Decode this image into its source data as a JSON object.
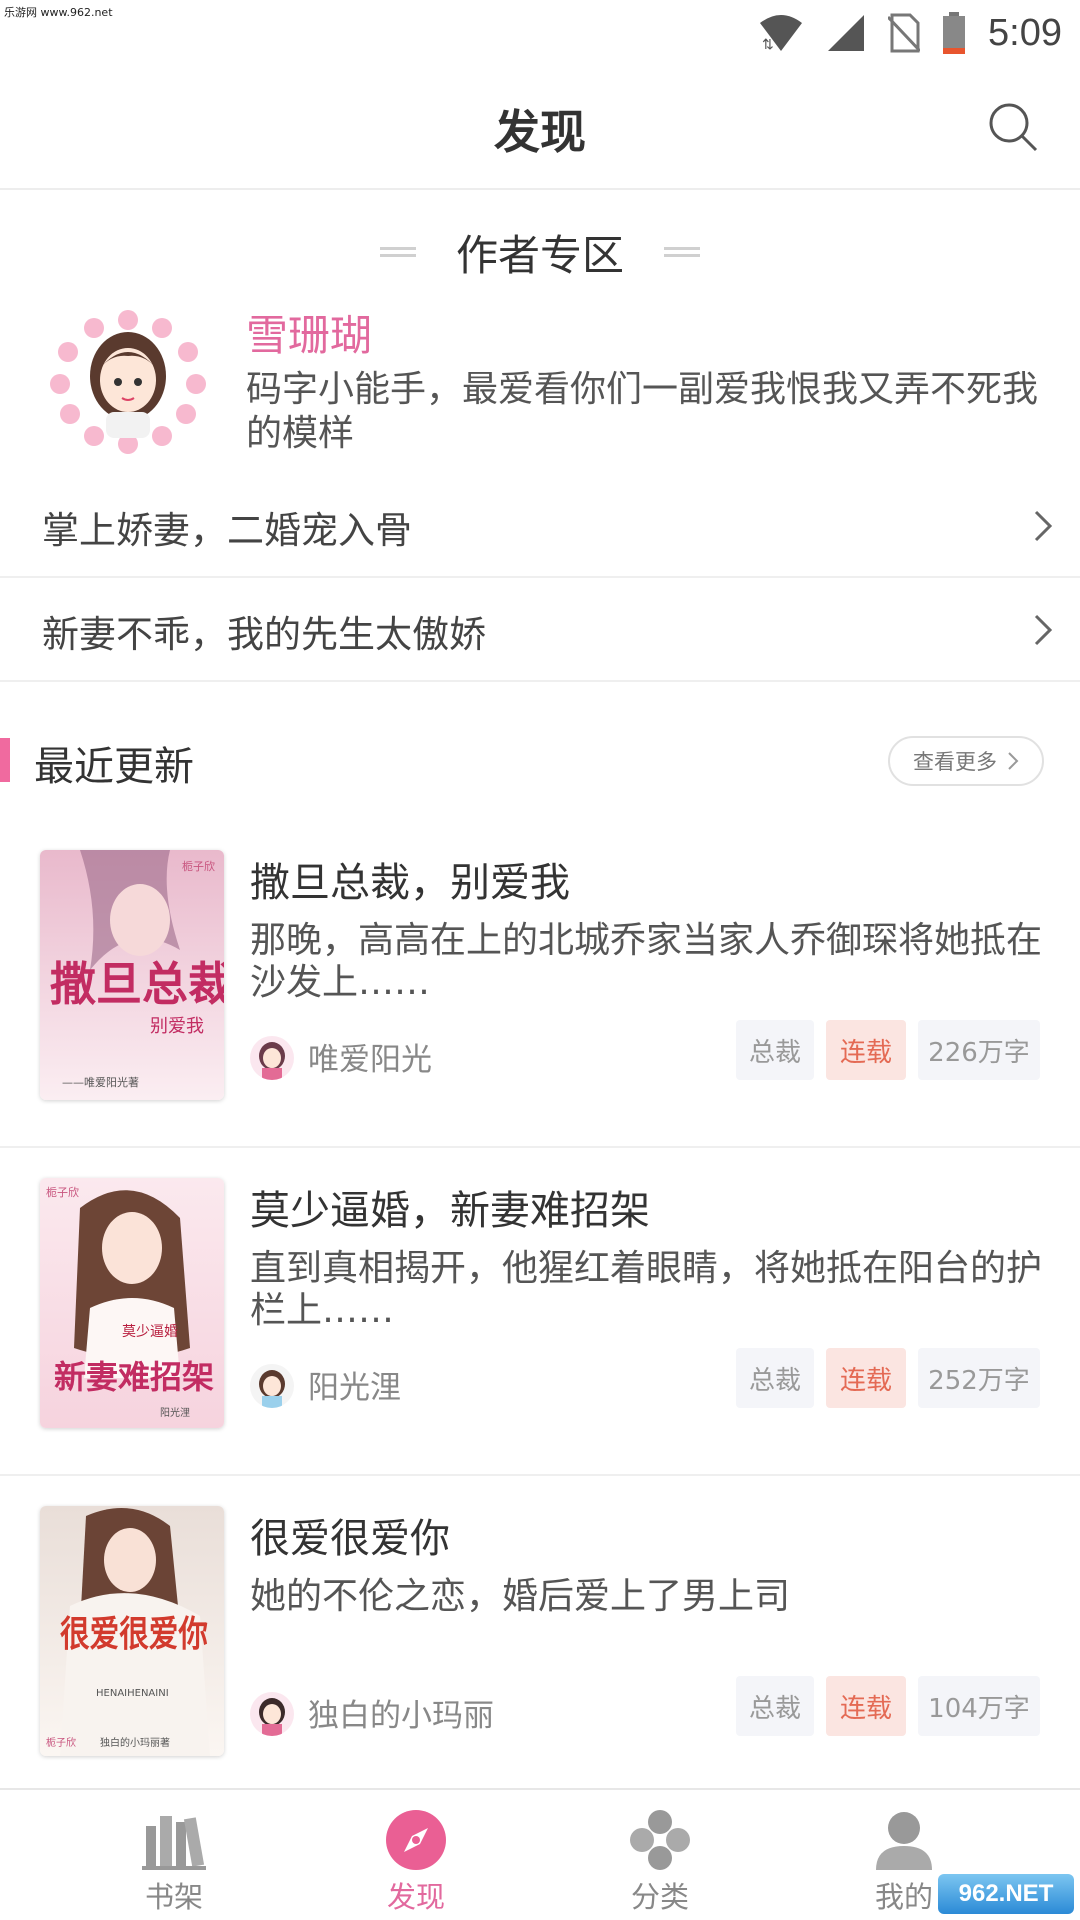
{
  "status_bar": {
    "watermark": "乐游网 www.962.net",
    "time": "5:09",
    "icons": [
      "wifi-icon",
      "signal-icon",
      "no-sim-icon",
      "battery-icon"
    ]
  },
  "header": {
    "title": "发现",
    "search_icon": "search-icon"
  },
  "author_section": {
    "title": "作者专区",
    "author": {
      "name": "雪珊瑚",
      "desc": "码字小能手，最爱看你们一副爱我恨我又弄不死我的模样"
    },
    "books": [
      {
        "title": "掌上娇妻，二婚宠入骨"
      },
      {
        "title": "新妻不乖，我的先生太傲娇"
      }
    ]
  },
  "recent": {
    "title": "最近更新",
    "more_label": "查看更多",
    "books": [
      {
        "title": "撒旦总裁，别爱我",
        "desc": "那晚，高高在上的北城乔家当家人乔御琛将她抵在沙发上……",
        "author": "唯爱阳光",
        "genre": "总裁",
        "status": "连载",
        "words": "226万字",
        "cover_title": "撒旦总裁",
        "cover_sub": "别爱我",
        "cover_author": "——唯爱阳光著",
        "cover_logo": "栀子欣"
      },
      {
        "title": "莫少逼婚，新妻难招架",
        "desc": "直到真相揭开，他猩红着眼睛，将她抵在阳台的护栏上……",
        "author": "阳光浬",
        "genre": "总裁",
        "status": "连载",
        "words": "252万字",
        "cover_title": "新妻难招架",
        "cover_sub": "莫少逼婚",
        "cover_author": "阳光浬",
        "cover_logo": "栀子欣"
      },
      {
        "title": "很爱很爱你",
        "desc": "她的不伦之恋，婚后爱上了男上司",
        "author": "独白的小玛丽",
        "genre": "总裁",
        "status": "连载",
        "words": "104万字",
        "cover_title": "很爱很爱你",
        "cover_sub": "HENAIHENAINI",
        "cover_author": "独白的小玛丽著",
        "cover_logo": "栀子欣"
      }
    ]
  },
  "bottom_nav": {
    "items": [
      {
        "label": "书架",
        "icon": "bookshelf-icon"
      },
      {
        "label": "发现",
        "icon": "compass-icon",
        "active": true
      },
      {
        "label": "分类",
        "icon": "category-icon"
      },
      {
        "label": "我的",
        "icon": "profile-icon"
      }
    ],
    "watermark": "962.NET"
  },
  "colors": {
    "accent_pink": "#e2699e",
    "tag_status_bg": "#fbe5e1",
    "tag_status_text": "#e46a54"
  }
}
